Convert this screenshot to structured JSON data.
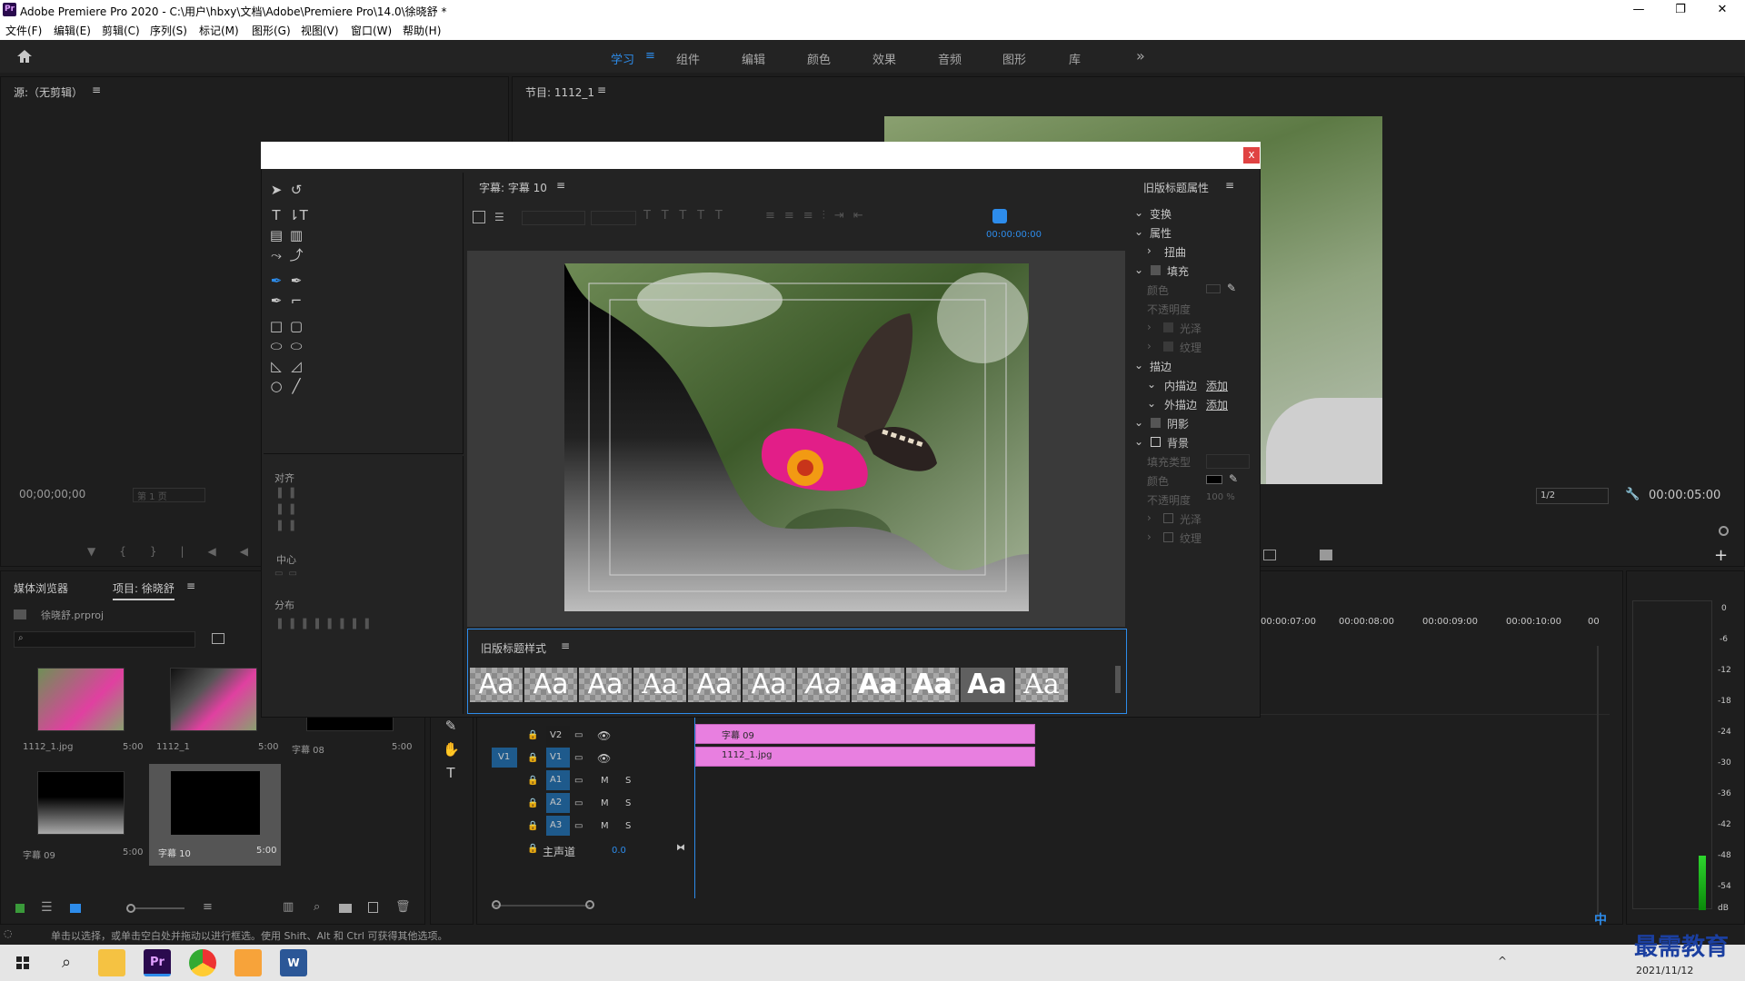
{
  "window": {
    "title": "Adobe Premiere Pro 2020 - C:\\用户\\hbxy\\文档\\Adobe\\Premiere Pro\\14.0\\徐晓舒 *",
    "app_badge": "Pr",
    "minimize": "—",
    "restore": "❐",
    "close": "✕"
  },
  "menu": [
    "文件(F)",
    "编辑(E)",
    "剪辑(C)",
    "序列(S)",
    "标记(M)",
    "图形(G)",
    "视图(V)",
    "窗口(W)",
    "帮助(H)"
  ],
  "workspaces": {
    "items": [
      "学习",
      "组件",
      "编辑",
      "颜色",
      "效果",
      "音频",
      "图形",
      "库"
    ],
    "active": "学习",
    "more": "»"
  },
  "source_panel": {
    "title": "源:（无剪辑）",
    "timecode": "00;00;00;00",
    "page": "第 1 页"
  },
  "program_panel": {
    "title": "节目: 1112_1",
    "scale": "1/2",
    "timecode": "00:00:05:00"
  },
  "title_dialog": {
    "close": "x",
    "title_panel": "字幕: 字幕 10",
    "timecode": "00:00:00:00",
    "align_label": "对齐",
    "center_label": "中心",
    "distribute_label": "分布",
    "styles_panel": "旧版标题样式",
    "style_sample": "Aa",
    "props_panel": "旧版标题属性",
    "props": {
      "transform": "变换",
      "attributes": "属性",
      "distort": "扭曲",
      "fill": "填充",
      "color": "颜色",
      "opacity": "不透明度",
      "sheen": "光泽",
      "texture": "纹理",
      "stroke": "描边",
      "inner_stroke": "内描边",
      "outer_stroke": "外描边",
      "add": "添加",
      "shadow": "阴影",
      "background": "背景",
      "fill_type": "填充类型",
      "bg_color": "颜色",
      "bg_opacity": "不透明度",
      "bg_opacity_value": "100 %",
      "bg_sheen": "光泽",
      "bg_texture": "纹理"
    }
  },
  "project_panel": {
    "tabs": [
      "媒体浏览器",
      "项目: 徐晓舒"
    ],
    "file": "徐晓舒.prproj",
    "items": [
      {
        "name": "1112_1.jpg",
        "dur": "5:00"
      },
      {
        "name": "1112_1",
        "dur": "5:00"
      },
      {
        "name": "字幕 08",
        "dur": "5:00"
      },
      {
        "name": "字幕 09",
        "dur": "5:00"
      },
      {
        "name": "字幕 10",
        "dur": "5:00"
      }
    ]
  },
  "timeline": {
    "ruler": [
      "00:00:07:00",
      "00:00:08:00",
      "00:00:09:00",
      "00:00:10:00",
      "00"
    ],
    "tracks": [
      {
        "id": "V2",
        "m": "",
        "s": ""
      },
      {
        "id": "V1",
        "m": "",
        "s": ""
      },
      {
        "id": "A1",
        "m": "M",
        "s": "S"
      },
      {
        "id": "A2",
        "m": "M",
        "s": "S"
      },
      {
        "id": "A3",
        "m": "M",
        "s": "S"
      }
    ],
    "v1_source": "V1",
    "master": "主声道",
    "master_value": "0.0",
    "clips": [
      {
        "name": "字幕 09"
      },
      {
        "name": "1112_1.jpg"
      }
    ]
  },
  "meter": {
    "labels": [
      "0",
      "-6",
      "-12",
      "-18",
      "-24",
      "-30",
      "-36",
      "-42",
      "-48",
      "-54",
      "dB"
    ]
  },
  "status_bar": "单击以选择，或单击空白处并拖动以进行框选。使用 Shift、Alt 和 Ctrl 可获得其他选项。",
  "taskbar": {
    "date": "2021/11/12",
    "ime": "中",
    "watermark": "最需教育"
  }
}
